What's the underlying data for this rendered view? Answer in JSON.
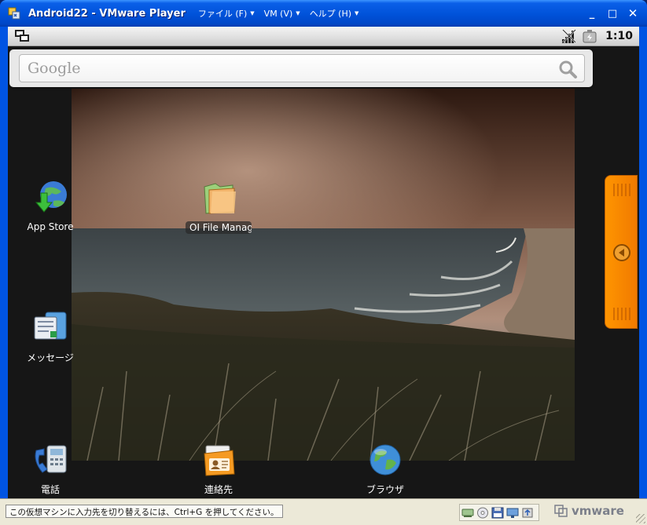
{
  "window": {
    "title": "Android22 - VMware Player",
    "menu": [
      {
        "label": "ファイル (F)"
      },
      {
        "label": "VM (V)"
      },
      {
        "label": "ヘルプ (H)"
      }
    ],
    "controls": {
      "minimize": "_",
      "maximize": "□",
      "close": "✕"
    }
  },
  "statusbar": {
    "time": "1:10",
    "icons": [
      "usb-debug-icon",
      "no-signal-icon",
      "battery-charging-icon"
    ]
  },
  "search": {
    "brand": "Google",
    "icon": "magnifier-icon"
  },
  "home": {
    "icons": [
      {
        "label": "App Store",
        "icon": "app-store-icon"
      },
      {
        "label": "OI File Manag",
        "icon": "folder-icon"
      },
      {
        "label": "メッセージ",
        "icon": "messages-icon"
      },
      {
        "label": "電話",
        "icon": "phone-icon"
      },
      {
        "label": "連絡先",
        "icon": "contacts-icon"
      },
      {
        "label": "ブラウザ",
        "icon": "browser-globe-icon"
      }
    ],
    "drawer": {
      "icon": "left-arrow-icon"
    }
  },
  "player_status": {
    "hint": "この仮想マシンに入力先を切り替えるには、Ctrl+G を押してください。",
    "brand": "vmware",
    "devices": [
      "network-icon",
      "cd-icon",
      "floppy-icon",
      "display-icon",
      "usb-icon"
    ]
  },
  "colors": {
    "titlebar": "#0054e3",
    "drawer": "#ff9500",
    "player_status_bg": "#ece9d8"
  }
}
